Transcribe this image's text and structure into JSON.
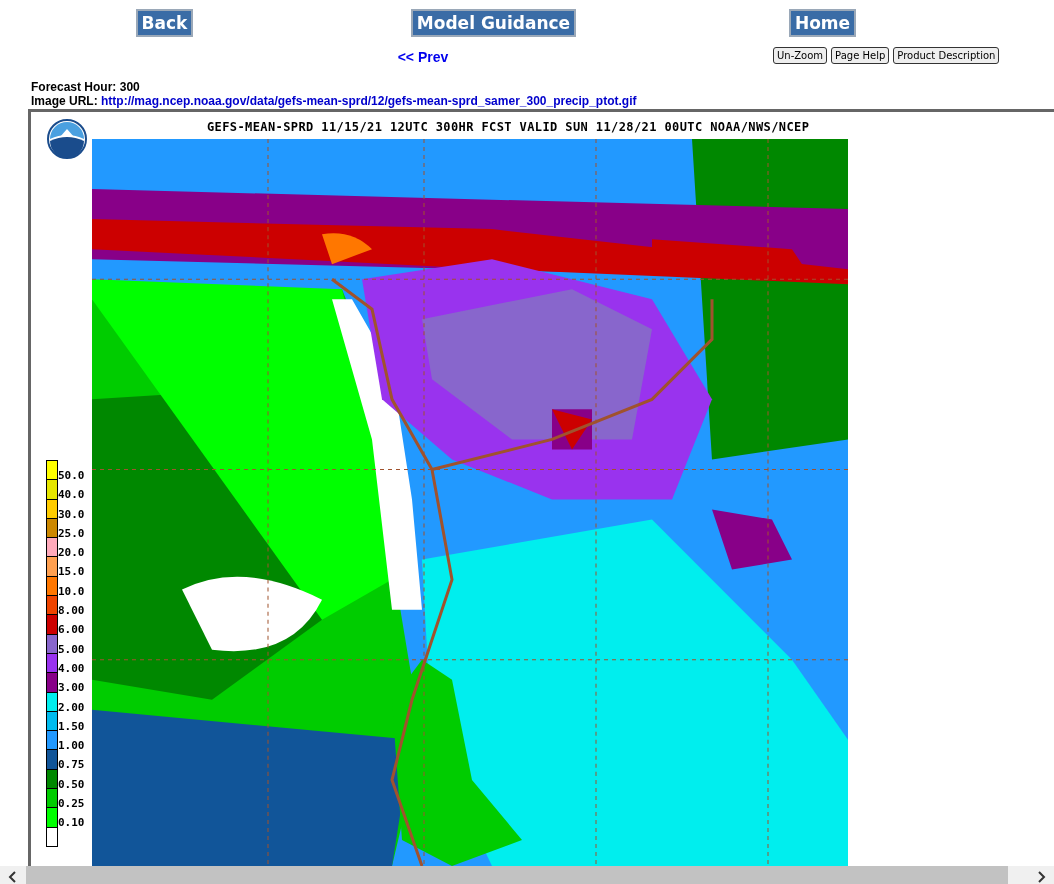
{
  "nav_buttons": [
    "Back",
    "Model Guidance",
    "Home"
  ],
  "prev_link": "<< Prev",
  "tool_buttons": [
    "Un-Zoom",
    "Page Help",
    "Product Description"
  ],
  "forecast_hour": {
    "label": "Forecast Hour:",
    "value": "300"
  },
  "image_url": {
    "label": "Image URL:",
    "value": "http://mag.ncep.noaa.gov/data/gefs-mean-sprd/12/gefs-mean-sprd_samer_300_precip_ptot.gif"
  },
  "map": {
    "title": "GEFS-MEAN-SPRD 11/15/21 12UTC 300HR FCST VALID SUN 11/28/21 00UTC NOAA/NWS/NCEP",
    "legend": [
      {
        "color": "#ffff00",
        "label": "50.0"
      },
      {
        "color": "#e6e600",
        "label": "40.0"
      },
      {
        "color": "#ffcc00",
        "label": "30.0"
      },
      {
        "color": "#cc8800",
        "label": "25.0"
      },
      {
        "color": "#ffaabb",
        "label": "20.0"
      },
      {
        "color": "#ffa050",
        "label": "15.0"
      },
      {
        "color": "#ff7700",
        "label": "10.0"
      },
      {
        "color": "#ee4400",
        "label": "8.00"
      },
      {
        "color": "#cc0000",
        "label": "6.00"
      },
      {
        "color": "#8866cc",
        "label": "5.00"
      },
      {
        "color": "#9933ee",
        "label": "4.00"
      },
      {
        "color": "#880088",
        "label": "3.00"
      },
      {
        "color": "#00eeee",
        "label": "2.00"
      },
      {
        "color": "#00bbee",
        "label": "1.50"
      },
      {
        "color": "#2299ff",
        "label": "1.00"
      },
      {
        "color": "#115599",
        "label": "0.75"
      },
      {
        "color": "#008800",
        "label": "0.50"
      },
      {
        "color": "#00cc00",
        "label": "0.25"
      },
      {
        "color": "#00ff00",
        "label": "0.10"
      },
      {
        "color": "#ffffff"
      }
    ]
  }
}
